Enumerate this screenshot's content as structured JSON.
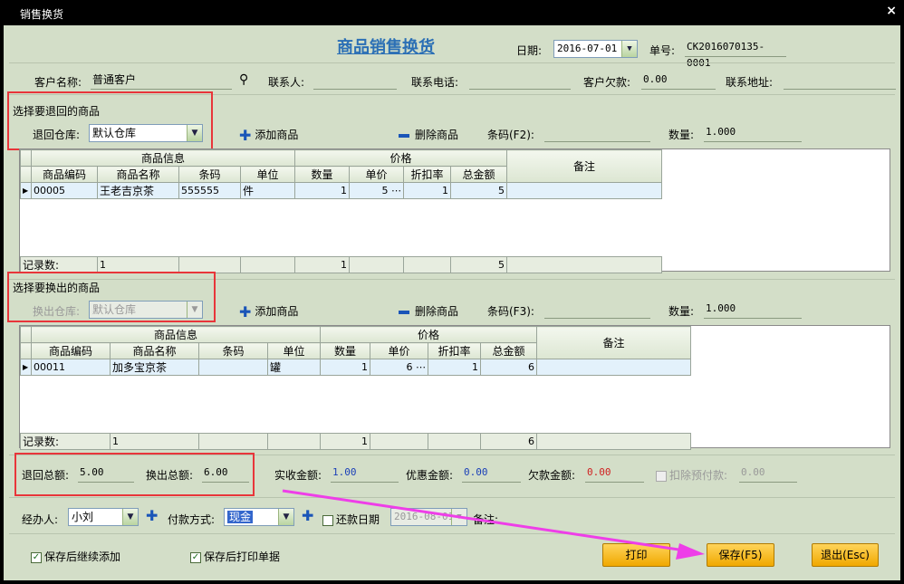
{
  "window": {
    "title": "销售换货",
    "close": "×"
  },
  "header": {
    "title": "商品销售换货",
    "date_label": "日期:",
    "date_value": "2016-07-01",
    "order_label": "单号:",
    "order_value": "CK2016070135-0001"
  },
  "customer": {
    "name_label": "客户名称:",
    "name_value": "普通客户",
    "contact_label": "联系人:",
    "phone_label": "联系电话:",
    "debt_label": "客户欠款:",
    "debt_value": "0.00",
    "address_label": "联系地址:"
  },
  "return_section": {
    "title": "选择要退回的商品",
    "warehouse_label": "退回仓库:",
    "warehouse_value": "默认仓库",
    "add_label": "添加商品",
    "delete_label": "删除商品",
    "barcode_label": "条码(F2):",
    "qty_label": "数量:",
    "qty_value": "1.000",
    "group_info": "商品信息",
    "group_price": "价格",
    "remark": "备注",
    "columns": [
      "商品编码",
      "商品名称",
      "条码",
      "单位",
      "数量",
      "单价",
      "折扣率",
      "总金额"
    ],
    "row": {
      "code": "00005",
      "name": "王老吉京茶",
      "barcode": "555555",
      "unit": "件",
      "qty": "1",
      "price": "5",
      "discount": "1",
      "total": "5"
    },
    "summary": {
      "label": "记录数:",
      "count": "1",
      "qty": "1",
      "total": "5"
    }
  },
  "exchange_section": {
    "title": "选择要换出的商品",
    "warehouse_label": "换出仓库:",
    "warehouse_value": "默认仓库",
    "add_label": "添加商品",
    "delete_label": "删除商品",
    "barcode_label": "条码(F3):",
    "qty_label": "数量:",
    "qty_value": "1.000",
    "group_info": "商品信息",
    "group_price": "价格",
    "remark": "备注",
    "columns": [
      "商品编码",
      "商品名称",
      "条码",
      "单位",
      "数量",
      "单价",
      "折扣率",
      "总金额"
    ],
    "row": {
      "code": "00011",
      "name": "加多宝京茶",
      "barcode": "",
      "unit": "罐",
      "qty": "1",
      "price": "6",
      "discount": "1",
      "total": "6"
    },
    "summary": {
      "label": "记录数:",
      "count": "1",
      "qty": "1",
      "total": "6"
    }
  },
  "totals": {
    "return_total_label": "退回总额:",
    "return_total": "5.00",
    "exchange_total_label": "换出总额:",
    "exchange_total": "6.00",
    "received_label": "实收金额:",
    "received": "1.00",
    "discount_label": "优惠金额:",
    "discount": "0.00",
    "owed_label": "欠款金额:",
    "owed": "0.00",
    "deduct_label": "扣除预付款:",
    "deduct": "0.00"
  },
  "footer": {
    "handler_label": "经办人:",
    "handler_value": "小刘",
    "payment_label": "付款方式:",
    "payment_value": "现金",
    "repay_label": "还款日期",
    "repay_value": "2016-08-01",
    "remark_label": "备注:",
    "opt_continue": "保存后继续添加",
    "opt_print": "保存后打印单据",
    "print_btn": "打印",
    "save_btn": "保存(F5)",
    "exit_btn": "退出(Esc)"
  },
  "colors": {
    "background": "#d3dec8",
    "title": "#2b6fb5",
    "annotation": "#e8353a",
    "arrow": "#ee3ee8"
  }
}
